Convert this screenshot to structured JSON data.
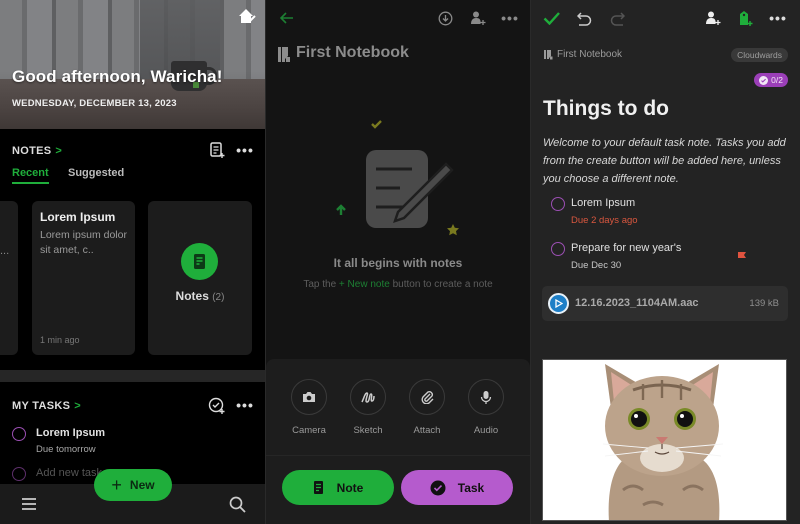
{
  "home": {
    "greeting": "Good afternoon, Waricha!",
    "date": "WEDNESDAY, DECEMBER 13, 2023",
    "notes_section": {
      "title": "NOTES",
      "chevron": ">",
      "tabs": [
        {
          "label": "Recent",
          "active": true
        },
        {
          "label": "Suggested",
          "active": false
        }
      ],
      "partial_card_text": "...",
      "cards": [
        {
          "title": "Lorem Ipsum",
          "body": "Lorem ipsum dolor sit amet, c..",
          "time": "1 min ago"
        }
      ],
      "notes_tile": {
        "label": "Notes",
        "count": "(2)"
      }
    },
    "tasks_section": {
      "title": "MY TASKS",
      "chevron": ">",
      "tasks": [
        {
          "title": "Lorem Ipsum",
          "due": "Due tomorrow"
        }
      ],
      "add_placeholder": "Add new task"
    },
    "new_button": {
      "icon": "+",
      "label": "New"
    },
    "icons": {
      "home_edit": "home-edit-icon",
      "new_note": "new-note-icon",
      "more": "more-icon",
      "task_add": "task-add-icon",
      "menu": "menu-icon",
      "search": "search-icon"
    }
  },
  "notebook": {
    "title": "First Notebook",
    "empty_heading": "It all begins with notes",
    "empty_sub_pre": "Tap the ",
    "empty_sub_link": "+ New note",
    "empty_sub_post": " button to create a note",
    "attachments": [
      {
        "label": "Camera",
        "icon": "camera-icon"
      },
      {
        "label": "Sketch",
        "icon": "sketch-icon"
      },
      {
        "label": "Attach",
        "icon": "paperclip-icon"
      },
      {
        "label": "Audio",
        "icon": "microphone-icon"
      }
    ],
    "note_button": "Note",
    "task_button": "Task"
  },
  "task_note": {
    "notebook": "First Notebook",
    "tag": "Cloudwards",
    "progress": "0/2",
    "title": "Things to do",
    "description": "Welcome to your default task note. Tasks you add from the create button will be added here, unless you choose a different note.",
    "tasks": [
      {
        "title": "Lorem Ipsum",
        "due": "Due 2 days ago",
        "overdue": true,
        "flagged": false
      },
      {
        "title": "Prepare for new year's",
        "due": "Due Dec 30",
        "overdue": false,
        "flagged": true
      }
    ],
    "audio": {
      "filename": "12.16.2023_1104AM.aac",
      "size": "139 kB"
    },
    "image_alt": "cat photo"
  },
  "colors": {
    "green": "#1fae3b",
    "purple": "#b55bcd",
    "overdue": "#d9573f",
    "blue": "#1e7fc7"
  }
}
